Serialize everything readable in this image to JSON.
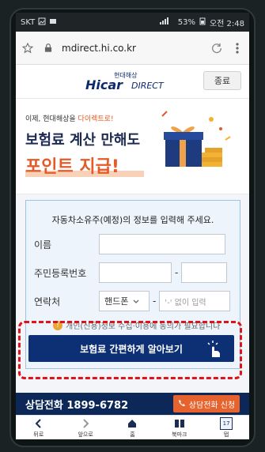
{
  "statusbar": {
    "carrier": "SKT",
    "battery": "53%",
    "time": "오전 2:48"
  },
  "browser": {
    "url": "mdirect.hi.co.kr"
  },
  "header": {
    "brand_small": "현대해상",
    "logo_main": "Hicar",
    "logo_sub": "DIRECT",
    "close_label": "종료"
  },
  "banner": {
    "small_prefix": "이제, 현대해상을 ",
    "small_highlight": "다이렉트로!",
    "line1": "보험료 계산 만해도",
    "line2": "포인트 지급!"
  },
  "form": {
    "heading": "자동차소유주(예정)의 정보를 입력해 주세요.",
    "name_label": "이름",
    "rrn_label": "주민등록번호",
    "contact_label": "연락처",
    "phone_type": "핸드폰",
    "phone_hint": "'-' 없이 입력",
    "notice": "개인(신용)정보 수집·이용에 동의가 필요합니다"
  },
  "cta": {
    "label": "보험료 간편하게 알아보기"
  },
  "bottombar": {
    "call": "상담전화 1899-6782",
    "cta_label": "상담전화 신청"
  },
  "navbar": {
    "back": "뒤로",
    "forward": "앞으로",
    "home": "홈",
    "bookmarks": "북마크",
    "tabs": "탭",
    "tab_count": "17"
  },
  "colors": {
    "navy": "#0d2f73",
    "orange": "#e45b2a",
    "red_dash": "#e0121a",
    "section_bg": "#eef4fb"
  }
}
